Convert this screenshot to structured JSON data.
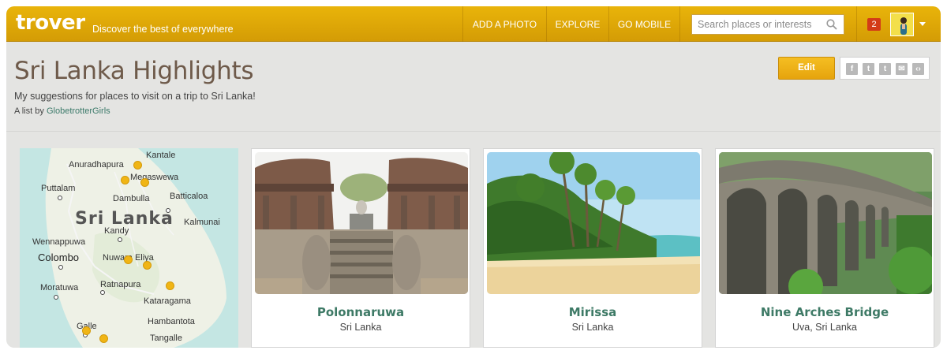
{
  "header": {
    "logo": "trover",
    "tagline": "Discover the best of everywhere",
    "nav": [
      {
        "label": "ADD A PHOTO"
      },
      {
        "label": "EXPLORE"
      },
      {
        "label": "GO MOBILE"
      }
    ],
    "search_placeholder": "Search places or interests",
    "notification_count": "2"
  },
  "list": {
    "title": "Sri Lanka Highlights",
    "description": "My suggestions for places to visit on a trip to Sri Lanka!",
    "byline_prefix": "A list by",
    "author": "GlobetrotterGirls",
    "edit_label": "Edit"
  },
  "share_icons": [
    "facebook-icon",
    "twitter-icon",
    "tumblr-icon",
    "email-icon",
    "embed-icon"
  ],
  "map": {
    "country": "Sri Lanka",
    "cities": [
      "Kantale",
      "Anuradhapura",
      "Megaswewa",
      "Puttalam",
      "Batticaloa",
      "Dambulla",
      "Kalmunai",
      "Kandy",
      "Wennappuwa",
      "Colombo",
      "Nuwara Eliya",
      "Ratnapura",
      "Moratuwa",
      "Kataragama",
      "Hambantota",
      "Galle",
      "Tangalle"
    ]
  },
  "places": [
    {
      "name": "Polonnaruwa",
      "location": "Sri Lanka"
    },
    {
      "name": "Mirissa",
      "location": "Sri Lanka"
    },
    {
      "name": "Nine Arches Bridge",
      "location": "Uva, Sri Lanka"
    }
  ],
  "colors": {
    "header": "#dca808",
    "accent_green": "#3e7a66",
    "title_brown": "#6e5a4a",
    "badge_red": "#d33b17"
  }
}
